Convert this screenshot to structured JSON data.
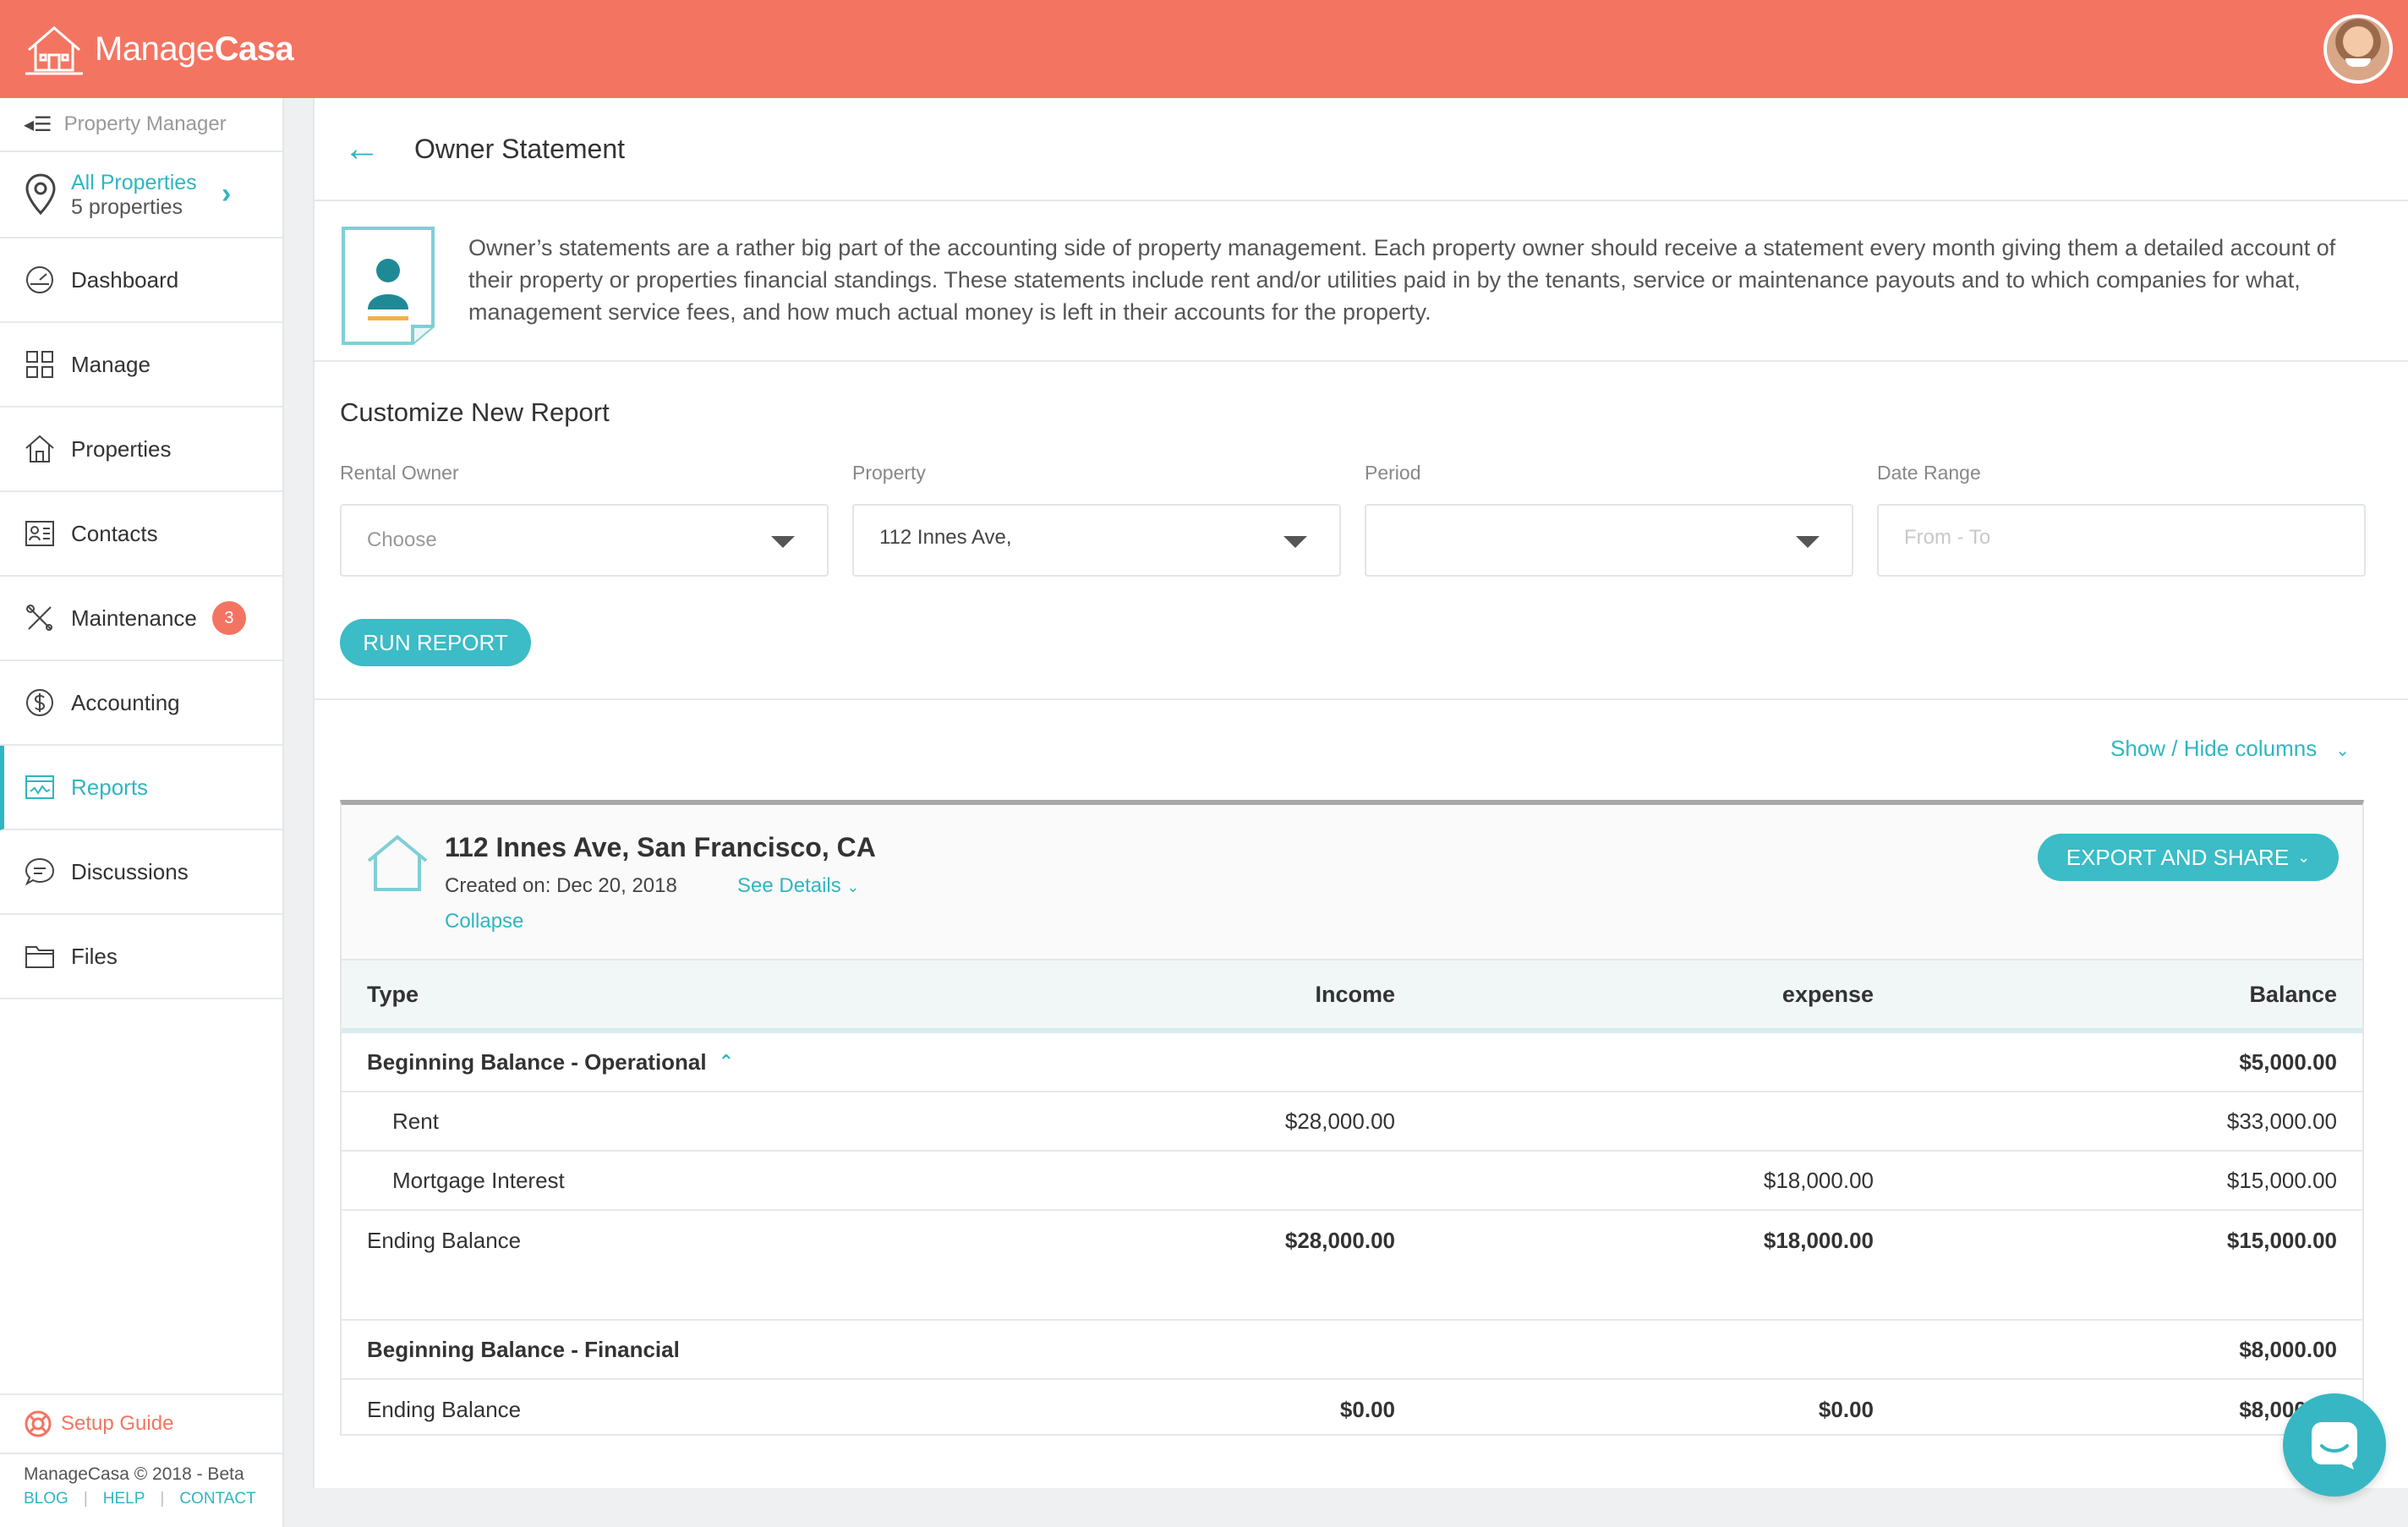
{
  "app": {
    "brand_light": "Manage",
    "brand_bold": "Casa",
    "accent_color": "#2fb6c1",
    "header_color": "#f47462"
  },
  "sidebar": {
    "role": "Property Manager",
    "properties": {
      "title": "All Properties",
      "count": "5 properties"
    },
    "items": [
      {
        "label": "Dashboard",
        "icon": "dashboard-icon"
      },
      {
        "label": "Manage",
        "icon": "grid-icon"
      },
      {
        "label": "Properties",
        "icon": "house-icon"
      },
      {
        "label": "Contacts",
        "icon": "contact-card-icon"
      },
      {
        "label": "Maintenance",
        "icon": "tools-icon",
        "badge": "3"
      },
      {
        "label": "Accounting",
        "icon": "dollar-icon"
      },
      {
        "label": "Reports",
        "icon": "report-icon",
        "active": true
      },
      {
        "label": "Discussions",
        "icon": "chat-icon"
      },
      {
        "label": "Files",
        "icon": "folder-icon"
      }
    ],
    "setup_guide": "Setup Guide",
    "footer": {
      "copyright": "ManageCasa © 2018 - Beta",
      "links": [
        "BLOG",
        "HELP",
        "CONTACT"
      ]
    }
  },
  "page": {
    "title": "Owner Statement",
    "intro": "Owner’s statements are a rather big part of the accounting side of property management. Each property owner should receive a statement every month giving them a detailed account of their property or properties financial standings. These statements include rent and/or utilities paid in by the tenants, service or maintenance payouts and to which companies for what, management service fees, and how much actual money is left in their accounts for the property.",
    "customize_title": "Customize New Report",
    "filters": {
      "rental_owner": {
        "label": "Rental Owner",
        "value": "Choose"
      },
      "property": {
        "label": "Property",
        "value": "112 Innes Ave,"
      },
      "period": {
        "label": "Period",
        "value": ""
      },
      "date_range": {
        "label": "Date Range",
        "placeholder": "From - To"
      }
    },
    "run_report": "RUN REPORT",
    "show_hide": "Show / Hide columns"
  },
  "report": {
    "address": "112 Innes Ave, San Francisco, CA",
    "created": "Created on: Dec 20, 2018",
    "see_details": "See Details",
    "collapse": "Collapse",
    "export": "EXPORT AND SHARE",
    "columns": {
      "type": "Type",
      "income": "Income",
      "expense": "expense",
      "balance": "Balance"
    },
    "rows": [
      {
        "type": "Beginning Balance - Operational",
        "income": "",
        "expense": "",
        "balance": "$5,000.00"
      },
      {
        "type": "Rent",
        "income": "$28,000.00",
        "expense": "",
        "balance": "$33,000.00"
      },
      {
        "type": "Mortgage Interest",
        "income": "",
        "expense": "$18,000.00",
        "balance": "$15,000.00"
      },
      {
        "type": "Ending Balance",
        "income": "$28,000.00",
        "expense": "$18,000.00",
        "balance": "$15,000.00"
      },
      {
        "type": "Beginning Balance - Financial",
        "income": "",
        "expense": "",
        "balance": "$8,000.00"
      },
      {
        "type": "Ending Balance",
        "income": "$0.00",
        "expense": "$0.00",
        "balance": "$8,000.00"
      }
    ]
  }
}
